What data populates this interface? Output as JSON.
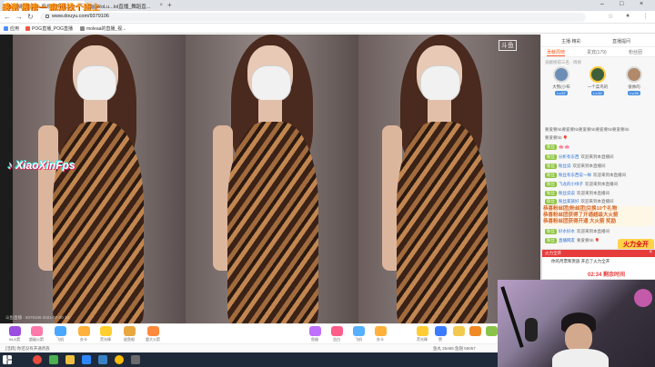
{
  "overlay_title": "感谢 周榜一 麻烦找个班上",
  "browser": {
    "tabs": [
      {
        "label": "感谢   周榜一 麻烦找个班上",
        "active": true
      },
      {
        "label": "RoLu...lol直播_舞蹈直...",
        "active": false
      }
    ],
    "url": "www.douyu.com/9379106",
    "bookmarks": [
      "应用",
      "POG直播_POG直播",
      "moleaa的直播_视..."
    ]
  },
  "video": {
    "tiktok_watermark": "XiaoXinFps",
    "channel_logo": "斗鱼",
    "meta": "斗鱼直播 · 9379106 2021-07-20 24"
  },
  "gift_bar": {
    "left_gifts": [
      "94火箭",
      "超级火箭",
      "飞机",
      "办卡",
      "荧光棒",
      "鲨鱼船",
      "超大火箭",
      "宝箱"
    ],
    "right_gifts": [
      "鱼翅",
      "告白",
      "飞机",
      "办卡",
      "荧光棒",
      "赞"
    ],
    "sub_left": "[活跃] 你还没有开通贵族",
    "sub_right": "鱼丸 25465   鱼翅 55057"
  },
  "panel": {
    "top_items": [
      "主播·精彩",
      "直播提问"
    ],
    "tabs": [
      "贡献周榜",
      "贵宾(179)",
      "粉丝团"
    ],
    "rank_header": "贡献榜前三名 · 周榜",
    "rank": [
      {
        "name": "大熊(小布",
        "level": "Lv.37"
      },
      {
        "name": "一个菜鸟的",
        "level": "Lv.32"
      },
      {
        "name": "很帅的",
        "level": "Lv.28"
      }
    ],
    "messages": [
      {
        "badge": "",
        "user": "",
        "text": "要爱要hb要爱要hb要爱要hb要爱要hb要爱要hb"
      },
      {
        "badge": "",
        "user": "",
        "text": "要爱要hb 🎈"
      },
      {
        "badge": "粉丝",
        "user": "",
        "text": "🐽 🐽"
      },
      {
        "badge": "粉丝",
        "user": "分析有东西",
        "text": "欢迎来到本直播间"
      },
      {
        "badge": "粉丝",
        "user": "粉丝说",
        "text": "欢迎来到本直播间"
      },
      {
        "badge": "粉丝",
        "user": "粉丝有东西说一样",
        "text": "欢迎来到本直播间"
      },
      {
        "badge": "粉丝",
        "user": "飞龙的小绿子",
        "text": "欢迎来到本直播间"
      },
      {
        "badge": "粉丝",
        "user": "粉丝说说",
        "text": "欢迎来到本直播间"
      },
      {
        "badge": "粉丝",
        "user": "粉丝家族好",
        "text": "欢迎来到本直播间"
      }
    ],
    "banner_lines": [
      "恭喜粉丝团[粉丝团]兑换10个礼物",
      "恭喜粉丝团获得了开通超级大火箭",
      "恭喜粉丝团获得开通 大火箭 奖励"
    ],
    "after_messages": [
      {
        "badge": "粉丝",
        "user": "好水好水",
        "text": "欢迎来到本直播间"
      },
      {
        "badge": "粉丝",
        "user": "直播网友",
        "text": "要爱要hb 🎈"
      }
    ],
    "full_badge": "火力全开",
    "popup": {
      "header": "火力全开",
      "text": "你的月票和贵族 开启了火力全开",
      "timer": "02:34 剩余时间"
    }
  },
  "colors": {
    "accent": "#ff5d23",
    "title_overlay": "#ff9c1a",
    "popup_red": "#e73c3c"
  }
}
